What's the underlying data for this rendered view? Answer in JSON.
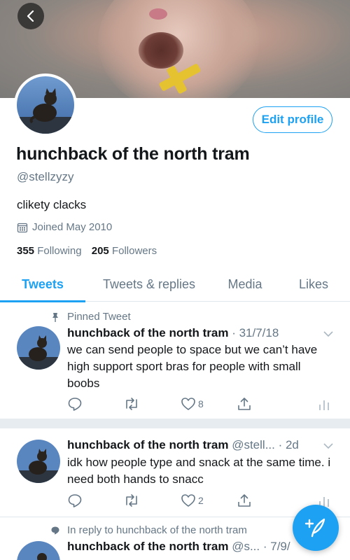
{
  "profile": {
    "display_name": "hunchback of the north tram",
    "handle": "@stellzyzy",
    "bio": "clikety clacks",
    "joined": "Joined May 2010",
    "following_count": "355",
    "following_label": "Following",
    "followers_count": "205",
    "followers_label": "Followers",
    "edit_label": "Edit profile"
  },
  "tabs": [
    {
      "label": "Tweets",
      "active": true
    },
    {
      "label": "Tweets & replies",
      "active": false
    },
    {
      "label": "Media",
      "active": false
    },
    {
      "label": "Likes",
      "active": false
    }
  ],
  "tweets": [
    {
      "context": "Pinned Tweet",
      "name": "hunchback of the north tram",
      "meta": "· 31/7/18",
      "text": "we can send people to space but we can’t have high support sport bras for people with small boobs",
      "likes": "8"
    },
    {
      "name": "hunchback of the north tram",
      "meta": "@stell... · 2d",
      "text": "idk how people type and snack at the same time. i need both hands to snacc",
      "likes": "2"
    },
    {
      "context": "In reply to hunchback of the north tram",
      "name": "hunchback of the north tram",
      "meta": "@s... · 7/9/"
    }
  ],
  "icons": {
    "back": "back-arrow-icon",
    "calendar": "calendar-icon",
    "pin": "pin-icon",
    "reply": "reply-icon",
    "retweet": "retweet-icon",
    "like": "heart-icon",
    "share": "share-icon",
    "analytics": "analytics-icon",
    "compose": "compose-icon"
  },
  "colors": {
    "accent": "#1da1f2",
    "secondary_text": "#657786",
    "divider": "#e6ecf0"
  }
}
